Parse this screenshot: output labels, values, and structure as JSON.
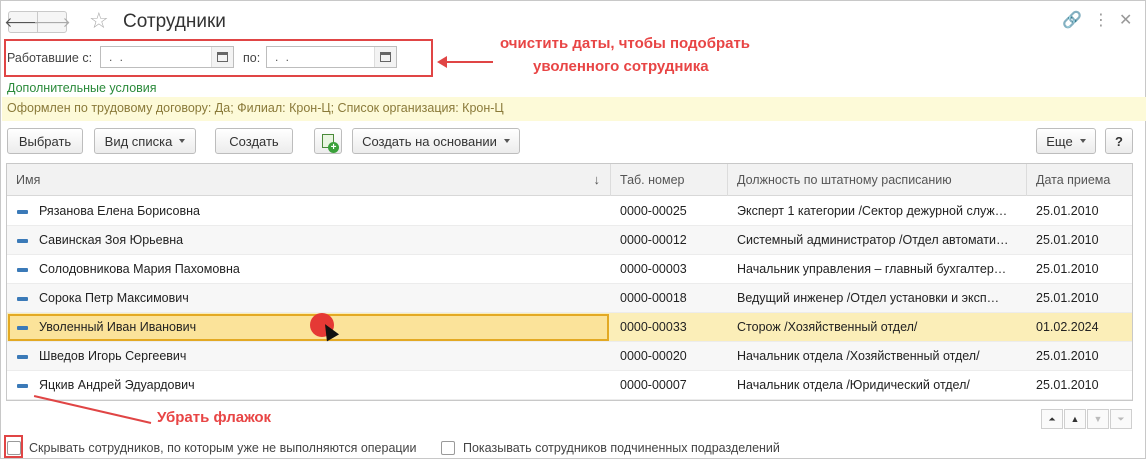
{
  "window": {
    "title": "Сотрудники"
  },
  "filter": {
    "from_label": "Работавшие с:",
    "from_value": ". .",
    "to_label": "по:",
    "to_value": ". ."
  },
  "annotations": {
    "dates_line1": "очистить даты, чтобы подобрать",
    "dates_line2": "уволенного сотрудника",
    "checkbox_note": "Убрать флажок"
  },
  "extra_conditions_link": "Дополнительные условия",
  "conditions_text": "Оформлен по трудовому договору: Да; Филиал: Крон-Ц; Список организация: Крон-Ц",
  "toolbar": {
    "select": "Выбрать",
    "view": "Вид списка",
    "create": "Создать",
    "create_based": "Создать на основании",
    "more": "Еще",
    "help": "?"
  },
  "table": {
    "columns": [
      "Имя",
      "Таб. номер",
      "Должность по штатному расписанию",
      "Дата приема"
    ],
    "rows": [
      {
        "name": "Рязанова Елена Борисовна",
        "num": "0000-00025",
        "pos": "Эксперт 1 категории /Сектор дежурной служ…",
        "date": "25.01.2010"
      },
      {
        "name": "Савинская Зоя Юрьевна",
        "num": "0000-00012",
        "pos": "Системный администратор /Отдел автомати…",
        "date": "25.01.2010"
      },
      {
        "name": "Солодовникова Мария Пахомовна",
        "num": "0000-00003",
        "pos": "Начальник управления – главный бухгалтер…",
        "date": "25.01.2010"
      },
      {
        "name": "Сорока Петр Максимович",
        "num": "0000-00018",
        "pos": "Ведущий инженер /Отдел установки и эксп…",
        "date": "25.01.2010"
      },
      {
        "name": "Уволенный Иван Иванович",
        "num": "0000-00033",
        "pos": "Сторож /Хозяйственный отдел/",
        "date": "01.02.2024"
      },
      {
        "name": "Шведов Игорь Сергеевич",
        "num": "0000-00020",
        "pos": "Начальник отдела /Хозяйственный отдел/",
        "date": "25.01.2010"
      },
      {
        "name": "Яцкив Андрей Эдуардович",
        "num": "0000-00007",
        "pos": "Начальник отдела /Юридический отдел/",
        "date": "25.01.2010"
      }
    ],
    "selected_row": 4
  },
  "checkboxes": {
    "hide_inactive": "Скрывать сотрудников, по которым уже не выполняются операции",
    "show_subordinate": "Показывать сотрудников подчиненных подразделений"
  },
  "colors": {
    "annotation": "#e84545",
    "selection": "#fbe39a",
    "conditions_bg": "#fdfad8",
    "link": "#2a8a3a"
  }
}
